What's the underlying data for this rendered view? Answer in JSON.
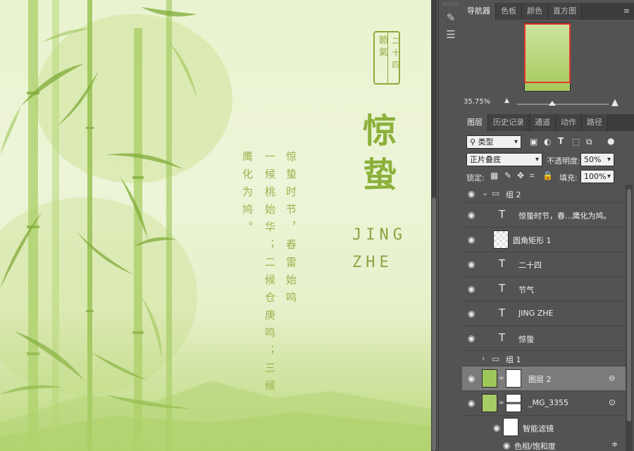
{
  "canvas": {
    "seal_jieqi": "節氣",
    "seal_number": "二十四",
    "title_cn": "惊蛰",
    "title_en_line1": "JING",
    "title_en_line2": "ZHE",
    "poem_col1": "惊蛰时节，春雷始鸣",
    "poem_col2": "一候桃始华；二候仓庚鸣；三候",
    "poem_col3": "鹰化为鸠。"
  },
  "toolstrip": {
    "tools": [
      "brush-icon",
      "adjust-sliders-icon"
    ]
  },
  "navigator_panel": {
    "tabs": [
      "导航器",
      "色板",
      "颜色",
      "直方图"
    ],
    "active_tab": "导航器",
    "zoom": "35.75%",
    "menu_icon": "panel-menu-icon"
  },
  "layers_panel": {
    "tabs": [
      "图层",
      "历史记录",
      "通道",
      "动作",
      "路径"
    ],
    "active_tab": "图层",
    "filter_kind": "类型",
    "blend_mode": "正片叠底",
    "opacity_label": "不透明度:",
    "opacity_value": "50%",
    "lock_label": "锁定:",
    "fill_label": "填充:",
    "fill_value": "100%",
    "layers": [
      {
        "name": "组 2",
        "kind": "group",
        "expanded": true
      },
      {
        "name": "惊蛰时节，春...鹰化为鸠。",
        "kind": "text"
      },
      {
        "name": "圆角矩形 1",
        "kind": "shape"
      },
      {
        "name": "二十四",
        "kind": "text"
      },
      {
        "name": "节气",
        "kind": "text"
      },
      {
        "name": "JING ZHE",
        "kind": "text"
      },
      {
        "name": "惊蛰",
        "kind": "text"
      },
      {
        "name": "组 1",
        "kind": "group",
        "expanded": false
      },
      {
        "name": "图层 2",
        "kind": "pixel",
        "selected": true
      },
      {
        "name": "_MG_3355",
        "kind": "smart-object"
      },
      {
        "name": "智能滤镜",
        "kind": "filter"
      },
      {
        "name": "色相/饱和度",
        "kind": "filter-item"
      }
    ]
  },
  "colors": {
    "accent_green": "#8cb13c",
    "panel_bg": "#535353",
    "selected_row": "#7b7b7b",
    "nav_frame": "#e0362e"
  }
}
